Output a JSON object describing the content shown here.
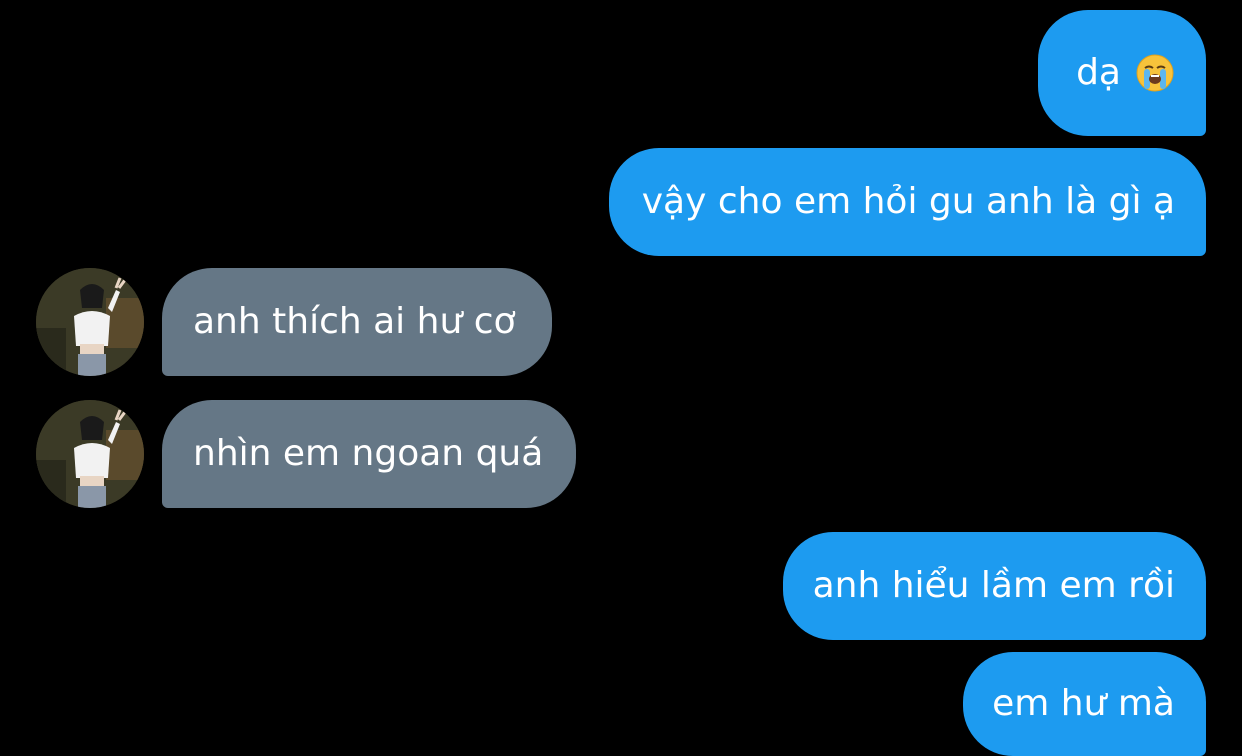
{
  "messages": [
    {
      "from": "me",
      "text": "dạ",
      "emoji": "loudly-crying-face-icon"
    },
    {
      "from": "me",
      "text": "vậy cho em hỏi gu anh là gì ạ"
    },
    {
      "from": "them",
      "text": "anh thích ai hư cơ"
    },
    {
      "from": "them",
      "text": "nhìn em ngoan quá"
    },
    {
      "from": "me",
      "text": "anh hiểu lầm em rồi"
    },
    {
      "from": "me",
      "text": "em hư mà"
    }
  ],
  "colors": {
    "background": "#000000",
    "outgoing_bubble": "#1D9BF0",
    "incoming_bubble": "#657786",
    "text": "#FFFFFF"
  }
}
